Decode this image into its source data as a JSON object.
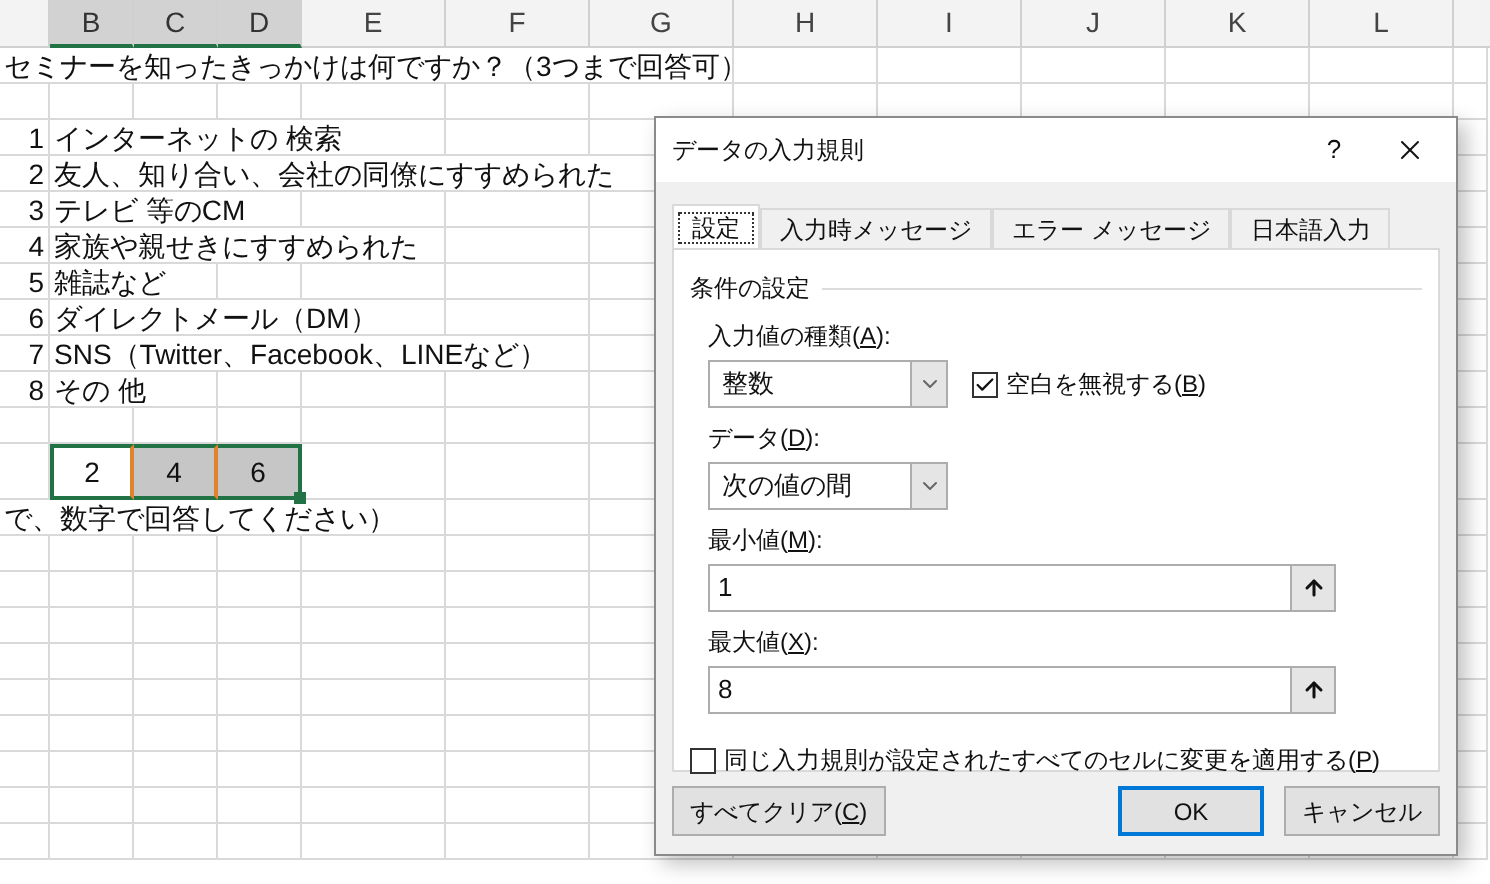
{
  "sheet": {
    "columns": [
      {
        "label": "B",
        "selected": true
      },
      {
        "label": "C",
        "selected": true
      },
      {
        "label": "D",
        "selected": true
      },
      {
        "label": "E",
        "selected": false
      },
      {
        "label": "F",
        "selected": false
      },
      {
        "label": "G",
        "selected": false
      },
      {
        "label": "H",
        "selected": false
      },
      {
        "label": "I",
        "selected": false
      },
      {
        "label": "J",
        "selected": false
      },
      {
        "label": "K",
        "selected": false
      },
      {
        "label": "L",
        "selected": false
      }
    ],
    "rows": [
      {
        "kind": "heading",
        "text": "セミナーを知ったきっかけは何ですか？（3つまで回答可）"
      },
      {
        "kind": "blank"
      },
      {
        "kind": "item",
        "number": "1",
        "text": "インターネットの 検索"
      },
      {
        "kind": "item",
        "number": "2",
        "text": "友人、知り合い、会社の同僚にすすめられた"
      },
      {
        "kind": "item",
        "number": "3",
        "text": "テレビ 等のCM"
      },
      {
        "kind": "item",
        "number": "4",
        "text": "家族や親せきにすすめられた"
      },
      {
        "kind": "item",
        "number": "5",
        "text": "雑誌など"
      },
      {
        "kind": "item",
        "number": "6",
        "text": "ダイレクトメール（DM）"
      },
      {
        "kind": "item",
        "number": "7",
        "text": "SNS（Twitter、Facebook、LINEなど）"
      },
      {
        "kind": "item",
        "number": "8",
        "text": "その 他"
      },
      {
        "kind": "blank"
      },
      {
        "kind": "selection",
        "cells": [
          {
            "value": "2",
            "active": true
          },
          {
            "value": "4",
            "active": false
          },
          {
            "value": "6",
            "active": false
          }
        ]
      },
      {
        "kind": "heading",
        "text": "で、数字で回答してください）"
      }
    ]
  },
  "dialog": {
    "title": "データの入力規則",
    "help": "?",
    "tabs": [
      {
        "label": "設定",
        "selected": true
      },
      {
        "label": "入力時メッセージ",
        "selected": false
      },
      {
        "label": "エラー メッセージ",
        "selected": false
      },
      {
        "label": "日本語入力",
        "selected": false
      }
    ],
    "section": "条件の設定",
    "allow": {
      "label": {
        "before": "入力値の種類(",
        "key": "A",
        "after": "):"
      },
      "value": "整数"
    },
    "ignore_blank": {
      "label": {
        "before": "空白を無視する(",
        "key": "B",
        "after": ")"
      },
      "checked": true
    },
    "data": {
      "label": {
        "before": "データ(",
        "key": "D",
        "after": "):"
      },
      "value": "次の値の間"
    },
    "minimum": {
      "label": {
        "before": "最小値(",
        "key": "M",
        "after": "):"
      },
      "value": "1"
    },
    "maximum": {
      "label": {
        "before": "最大値(",
        "key": "X",
        "after": "):"
      },
      "value": "8"
    },
    "apply_all": {
      "label": {
        "before": "同じ入力規則が設定されたすべてのセルに変更を適用する(",
        "key": "P",
        "after": ")"
      },
      "checked": false
    },
    "buttons": [
      {
        "label": {
          "before": "すべてクリア(",
          "key": "C",
          "after": ")"
        },
        "default": false
      },
      {
        "label": {
          "before": "OK"
        },
        "default": true
      },
      {
        "label": {
          "before": "キャンセル"
        },
        "default": false
      }
    ]
  }
}
